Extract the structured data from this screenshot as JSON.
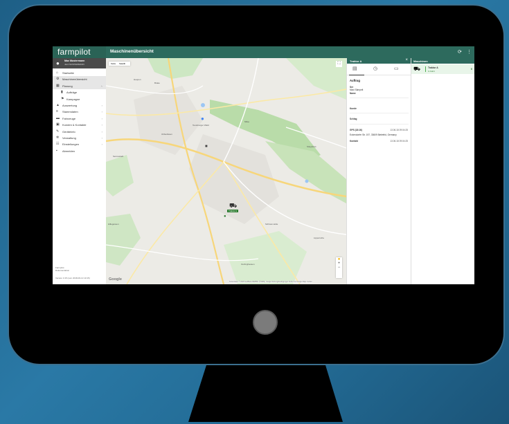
{
  "app": {
    "logo": "farmpilot",
    "title": "Maschinenübersicht",
    "refresh_icon": "refresh-icon",
    "menu_icon": "more-icon"
  },
  "user": {
    "name": "Max Mustermann",
    "company": "Janz MUSTERMANN"
  },
  "sidebar": {
    "items": [
      {
        "label": "Startseite",
        "icon": "home-icon"
      },
      {
        "label": "Maschinenübersicht",
        "icon": "machine-icon"
      },
      {
        "label": "Planung",
        "icon": "planning-icon"
      },
      {
        "label": "Aufträge",
        "icon": "order-icon"
      },
      {
        "label": "Kampagne",
        "icon": "flag-icon"
      },
      {
        "label": "Auswertung",
        "icon": "chart-icon"
      },
      {
        "label": "Stammdaten",
        "icon": "database-icon"
      },
      {
        "label": "Fahrzeuge",
        "icon": "truck-icon"
      },
      {
        "label": "Kunden & Kontakte",
        "icon": "contacts-icon"
      },
      {
        "label": "Geräteinfo",
        "icon": "wrench-icon"
      },
      {
        "label": "Verwaltung",
        "icon": "admin-icon"
      },
      {
        "label": "Einstellungen",
        "icon": "settings-icon"
      },
      {
        "label": "Abmelden",
        "icon": "logout-icon"
      }
    ],
    "footer_company": "Farmpilot",
    "footer_sub": "Dokumentation",
    "version": "Version 3.15 (vom 2018-06-13 13:15)"
  },
  "map": {
    "types": [
      "Karte",
      "Satellit"
    ],
    "google": "Google",
    "attribution": "Kartendaten © 2018 GeoBasis-DE/BKG (©2009), Google   Nutzungsbedingungen   Fehler bei Google Maps melden",
    "places": [
      "Heepen",
      "Brake",
      "Milse",
      "Ubbedissen",
      "Sennestadt",
      "Stieghorst",
      "Hillegossen",
      "Schloss Holte",
      "Lipperreihe",
      "Oerlinghausen",
      "Teutoburger Wald"
    ],
    "marker_label": "Traktor A"
  },
  "detail": {
    "header": "Traktor A",
    "section_title": "Auftrag",
    "rows": [
      {
        "label": "Ser",
        "value": ""
      },
      {
        "label": "Maxi Sämpelt",
        "value": ""
      },
      {
        "label": "Name",
        "value": ""
      }
    ],
    "kunde_label": "Kunde",
    "schlag_label": "Schlag",
    "gps_label": "GPS (18:16)",
    "gps_time": "13.06.18 09:04:25",
    "address": "Eckendorfer Str. 197, 33609 Bielefeld, Germany",
    "kontakt_label": "Kontakt",
    "kontakt_time": "13.06.18 09:04:25"
  },
  "machines": {
    "header": "Maschinen",
    "items": [
      {
        "name": "Traktor A",
        "status": "In Fahrt",
        "indicator": "0"
      }
    ]
  }
}
